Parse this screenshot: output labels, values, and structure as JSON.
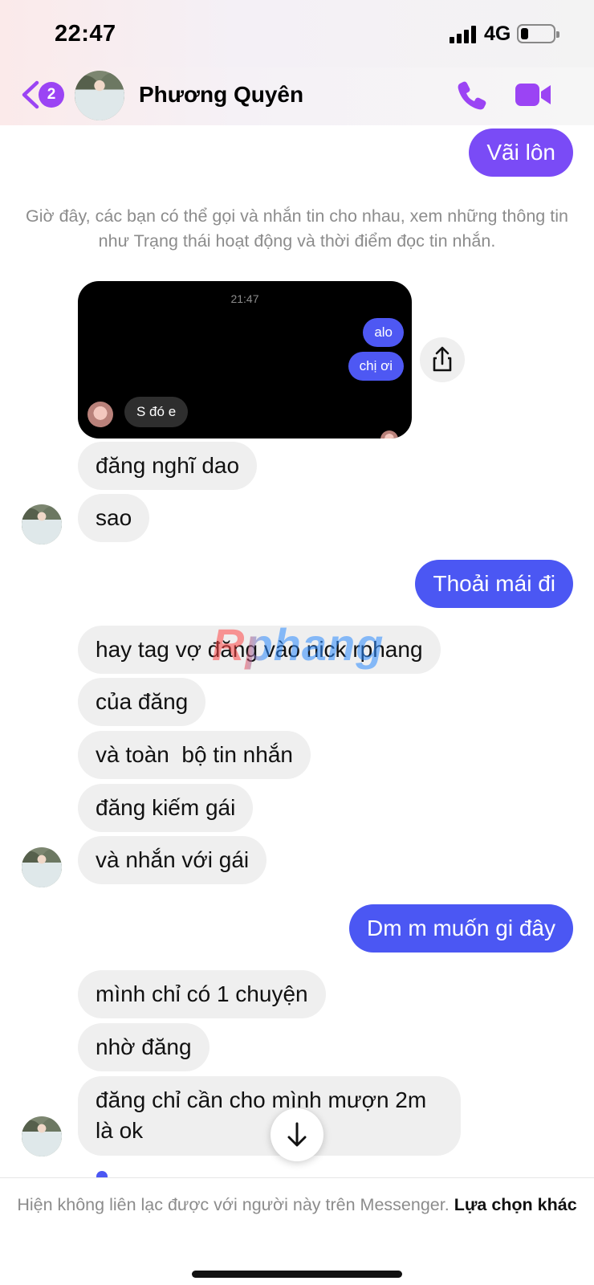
{
  "status_bar": {
    "time": "22:47",
    "network": "4G"
  },
  "header": {
    "badge_count": "2",
    "contact_name": "Phương Quyên"
  },
  "system_note": "Giờ đây, các bạn có thể gọi và nhắn tin cho nhau, xem những thông tin như Trạng thái hoạt động và thời điểm đọc tin nhắn.",
  "screenshot": {
    "time": "21:47",
    "out_messages": [
      "alo",
      "chị ơi"
    ],
    "in_message": "S đó e"
  },
  "messages": {
    "m1": "Vãi lôn",
    "m2": "đăng nghĩ dao",
    "m3": "sao",
    "m4": "Thoải mái đi",
    "m5": "hay tag vợ đăng vào nick rphang",
    "m6": "của đăng",
    "m7": "và toàn  bộ tin nhắn",
    "m8": "đăng kiếm gái",
    "m9": "và nhắn với gái",
    "m10": "Dm m muốn gi đây",
    "m11": "mình chỉ có 1 chuyện",
    "m12": "nhờ đăng",
    "m13a": "đăng chỉ cần cho mình mượn 2m",
    "m13b": "là ok"
  },
  "watermark": "Rphang",
  "footer": {
    "text": "Hiện không liên lạc được với người này trên Messenger.",
    "link": "Lựa chọn khác"
  },
  "colors": {
    "accent": "#9b44f4",
    "outgoing_purple": "#7a4bf6",
    "outgoing_blue": "#4b57f3",
    "incoming": "#efefef"
  },
  "icons": [
    "back-chevron-icon",
    "phone-icon",
    "video-camera-icon",
    "share-icon",
    "arrow-down-icon"
  ]
}
